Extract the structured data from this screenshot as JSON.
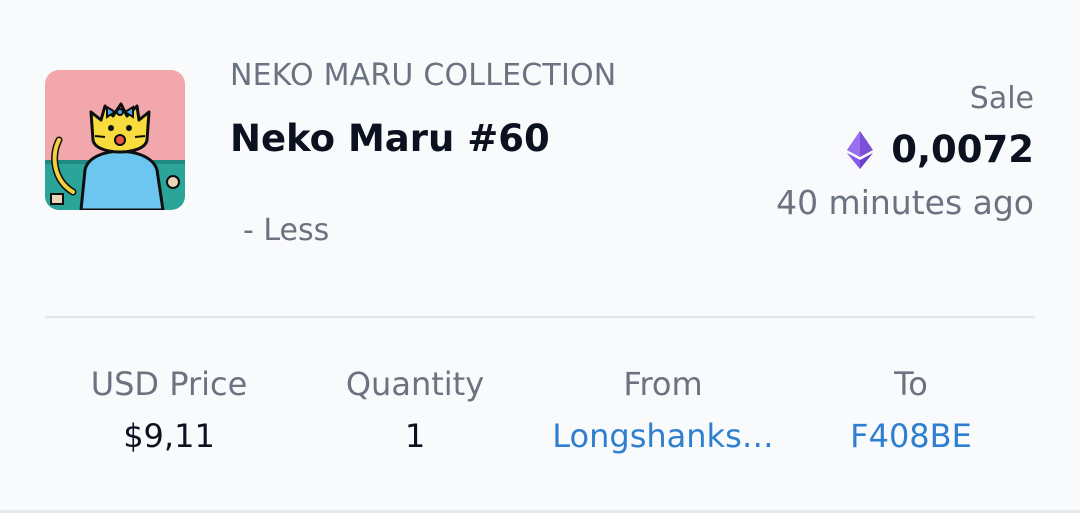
{
  "item": {
    "image_icon": "cat-nft-thumbnail",
    "collection": "NEKO MARU COLLECTION",
    "name": "Neko Maru #60",
    "less_toggle": "- Less"
  },
  "sale": {
    "type": "Sale",
    "currency_icon": "ethereum-icon",
    "price": "0,0072",
    "time_ago": "40 minutes ago"
  },
  "stats": {
    "usd_price_label": "USD Price",
    "usd_price_value": "$9,11",
    "quantity_label": "Quantity",
    "quantity_value": "1",
    "from_label": "From",
    "from_value": "Longshanks…",
    "to_label": "To",
    "to_value": "F408BE"
  },
  "colors": {
    "link": "#2f7fd0",
    "eth": "#7b4fd6",
    "thumb_bg": "#f2a7ad",
    "thumb_ground": "#2ba59a"
  }
}
